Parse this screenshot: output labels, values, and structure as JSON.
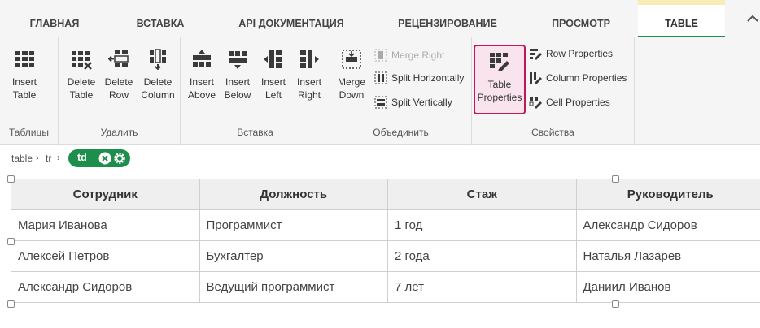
{
  "tabs": [
    {
      "label": "ГЛАВНАЯ"
    },
    {
      "label": "ВСТАВКА"
    },
    {
      "label": "API ДОКУМЕНТАЦИЯ"
    },
    {
      "label": "РЕЦЕНЗИРОВАНИЕ"
    },
    {
      "label": "ПРОСМОТР"
    },
    {
      "label": "TABLE",
      "active": true
    }
  ],
  "ribbon": {
    "groups": {
      "tables": {
        "label": "Таблицы",
        "insert_table": "Insert Table"
      },
      "delete": {
        "label": "Удалить",
        "delete_table": "Delete Table",
        "delete_row": "Delete Row",
        "delete_column": "Delete Column"
      },
      "insert": {
        "label": "Вставка",
        "insert_above": "Insert Above",
        "insert_below": "Insert Below",
        "insert_left": "Insert Left",
        "insert_right": "Insert Right"
      },
      "merge": {
        "label": "Объединить",
        "merge_down": "Merge Down",
        "merge_right": "Merge Right",
        "split_horizontally": "Split Horizontally",
        "split_vertically": "Split Vertically"
      },
      "properties": {
        "label": "Свойства",
        "table_properties": "Table Properties",
        "row_properties": "Row Properties",
        "column_properties": "Column Properties",
        "cell_properties": "Cell Properties"
      }
    }
  },
  "breadcrumb": {
    "items": [
      "table",
      "tr"
    ],
    "current": "td"
  },
  "table": {
    "headers": [
      "Сотрудник",
      "Должность",
      "Стаж",
      "Руководитель"
    ],
    "rows": [
      [
        "Мария Иванова",
        "Программист",
        "1 год",
        "Александр Сидоров"
      ],
      [
        "Алексей Петров",
        "Бухгалтер",
        "2 года",
        "Наталья Лазарев"
      ],
      [
        "Александр Сидоров",
        "Ведущий программист",
        "7 лет",
        "Даниил Иванов"
      ]
    ]
  },
  "colors": {
    "accent": "#1e8e4d",
    "selected_border": "#c2185b",
    "selected_bg": "#f9e3ec",
    "active_tab_top": "#f8eeb5"
  }
}
